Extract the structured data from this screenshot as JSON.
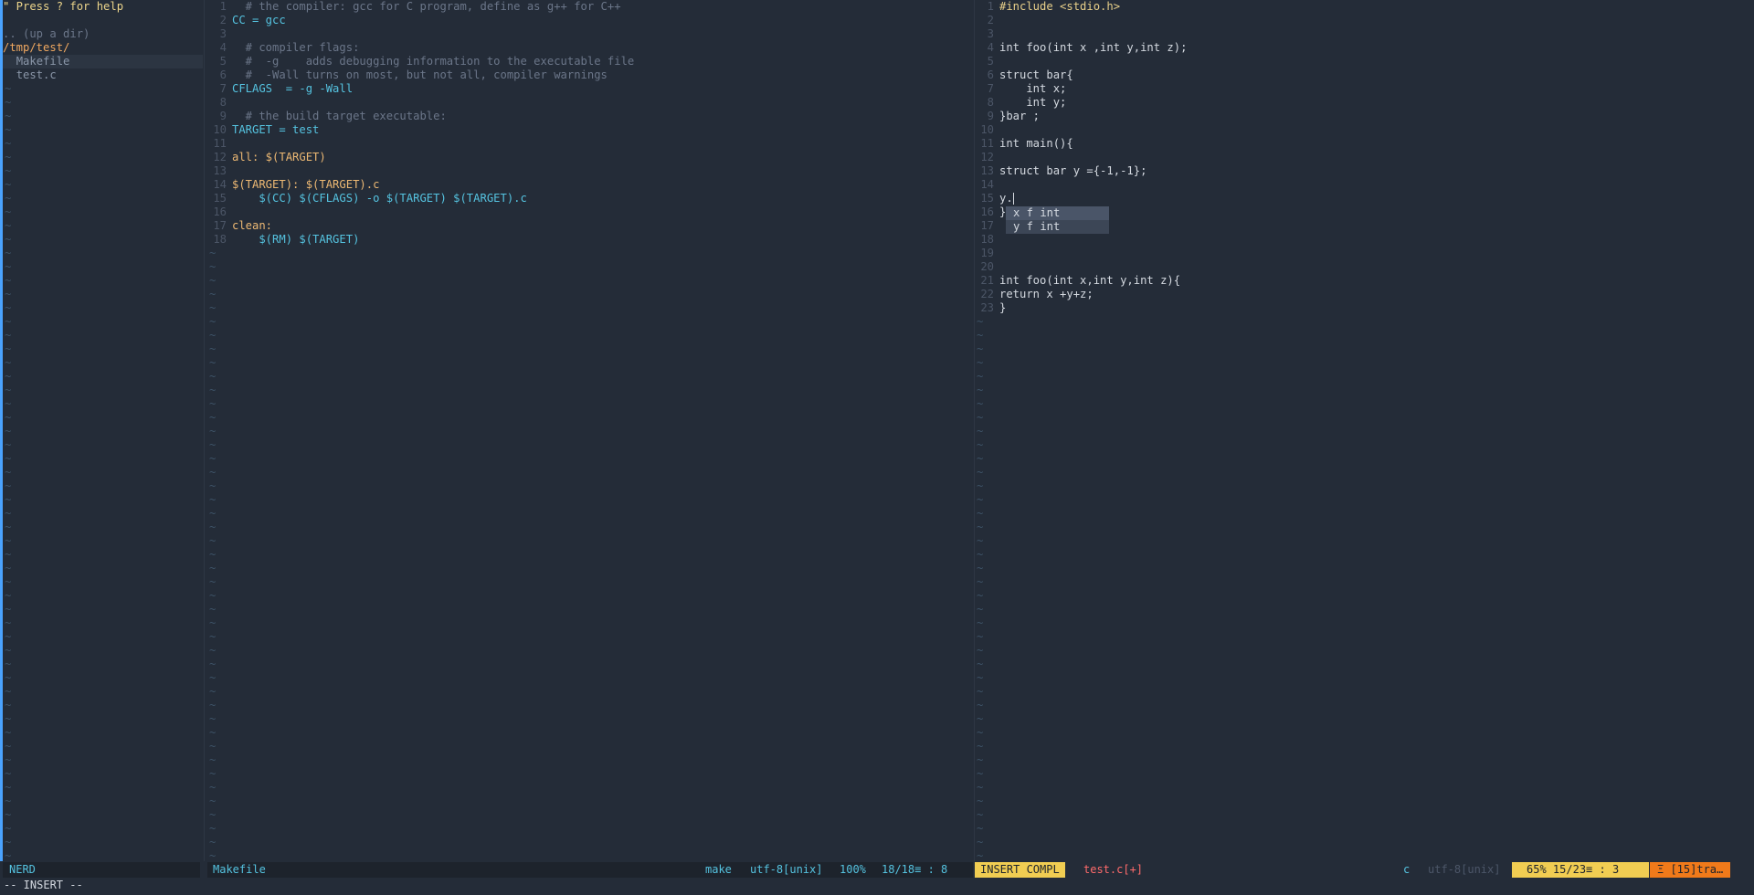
{
  "nerdtree": {
    "help": "\" Press ? for help",
    "up_dir": ".. (up a dir)",
    "root": "/tmp/test/",
    "files": [
      "Makefile",
      "test.c"
    ]
  },
  "makefile": {
    "lines": [
      {
        "n": "1",
        "t": "  # the compiler: gcc for C program, define as g++ for C++",
        "c": "comment"
      },
      {
        "n": "2",
        "t": "CC = gcc",
        "c": "var"
      },
      {
        "n": "3",
        "t": "",
        "c": "white"
      },
      {
        "n": "4",
        "t": "  # compiler flags:",
        "c": "comment"
      },
      {
        "n": "5",
        "t": "  #  -g    adds debugging information to the executable file",
        "c": "comment"
      },
      {
        "n": "6",
        "t": "  #  -Wall turns on most, but not all, compiler warnings",
        "c": "comment"
      },
      {
        "n": "7",
        "t": "CFLAGS  = -g -Wall",
        "c": "var"
      },
      {
        "n": "8",
        "t": "",
        "c": "white"
      },
      {
        "n": "9",
        "t": "  # the build target executable:",
        "c": "comment"
      },
      {
        "n": "10",
        "t": "TARGET = test",
        "c": "var"
      },
      {
        "n": "11",
        "t": "",
        "c": "white"
      },
      {
        "n": "12",
        "t": "all: $(TARGET)",
        "c": "orange"
      },
      {
        "n": "13",
        "t": "",
        "c": "white"
      },
      {
        "n": "14",
        "t": "$(TARGET): $(TARGET).c",
        "c": "orange"
      },
      {
        "n": "15",
        "t": "    $(CC) $(CFLAGS) -o $(TARGET) $(TARGET).c",
        "c": "var"
      },
      {
        "n": "16",
        "t": "",
        "c": "white"
      },
      {
        "n": "17",
        "t": "clean:",
        "c": "orange"
      },
      {
        "n": "18",
        "t": "    $(RM) $(TARGET)",
        "c": "var"
      }
    ]
  },
  "testc": {
    "lines": [
      {
        "n": "1",
        "t": "#include <stdio.h>",
        "c": "str"
      },
      {
        "n": "2",
        "t": "",
        "c": "white"
      },
      {
        "n": "3",
        "t": "",
        "c": "white"
      },
      {
        "n": "4",
        "t": "int foo(int x ,int y,int z);",
        "c": "white"
      },
      {
        "n": "5",
        "t": "",
        "c": "white"
      },
      {
        "n": "6",
        "t": "struct bar{",
        "c": "white"
      },
      {
        "n": "7",
        "t": "    int x;",
        "c": "white"
      },
      {
        "n": "8",
        "t": "    int y;",
        "c": "white"
      },
      {
        "n": "9",
        "t": "}bar ;",
        "c": "white"
      },
      {
        "n": "10",
        "t": "",
        "c": "white"
      },
      {
        "n": "11",
        "t": "int main(){",
        "c": "white"
      },
      {
        "n": "12",
        "t": "",
        "c": "white"
      },
      {
        "n": "13",
        "t": "struct bar y ={-1,-1};",
        "c": "white"
      },
      {
        "n": "14",
        "t": "",
        "c": "white"
      },
      {
        "n": "15",
        "t": "y.",
        "c": "white"
      },
      {
        "n": "16",
        "t": "}",
        "c": "white"
      },
      {
        "n": "17",
        "t": "",
        "c": "white"
      },
      {
        "n": "18",
        "t": "",
        "c": "white"
      },
      {
        "n": "19",
        "t": "",
        "c": "white"
      },
      {
        "n": "20",
        "t": "",
        "c": "white"
      },
      {
        "n": "21",
        "t": "int foo(int x,int y,int z){",
        "c": "white"
      },
      {
        "n": "22",
        "t": "return x +y+z;",
        "c": "white"
      },
      {
        "n": "23",
        "t": "}",
        "c": "white"
      }
    ],
    "completion": [
      "x f int",
      "y f int"
    ]
  },
  "status": {
    "nerd_label": "NERD",
    "make_file": "Makefile",
    "make_ft": "make",
    "make_enc": "utf-8[unix]",
    "make_pct": "100%",
    "make_pos": "18/18≡ :  8",
    "mode": "INSERT COMPL",
    "c_file": "test.c[+]",
    "c_ft": "c",
    "c_enc": "utf-8[unix]",
    "c_pct": "65%",
    "c_pos": "15/23≡ :  3",
    "c_warn": "Ξ [15]tra…"
  },
  "cmdline": "-- INSERT --"
}
